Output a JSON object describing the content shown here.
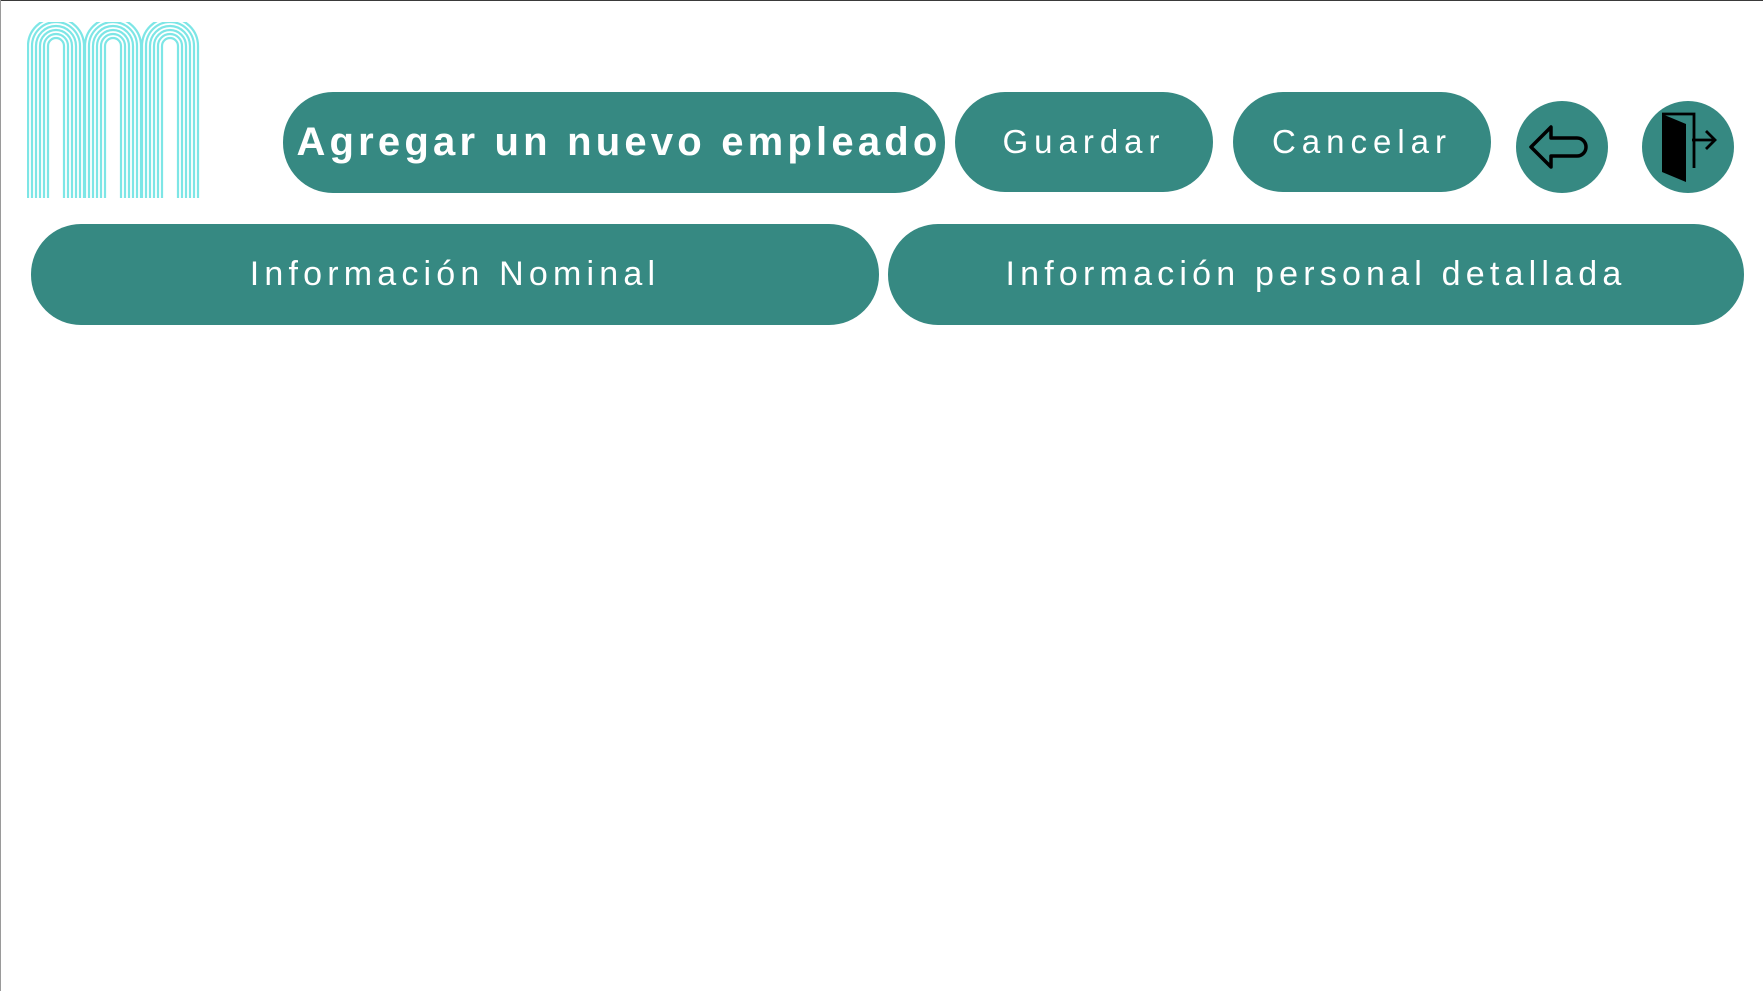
{
  "header": {
    "logo_name": "company-logo",
    "title": "Agregar un nuevo empleado",
    "save_label": "Guardar",
    "cancel_label": "Cancelar",
    "back_icon": "arrow-left-icon",
    "exit_icon": "door-exit-icon"
  },
  "sections": {
    "nominal_label": "Información Nominal",
    "personal_label": "Información personal detallada"
  },
  "colors": {
    "accent": "#368982",
    "logo": "#7de6e6",
    "text_on_accent": "#ffffff",
    "icon_stroke": "#000000"
  }
}
